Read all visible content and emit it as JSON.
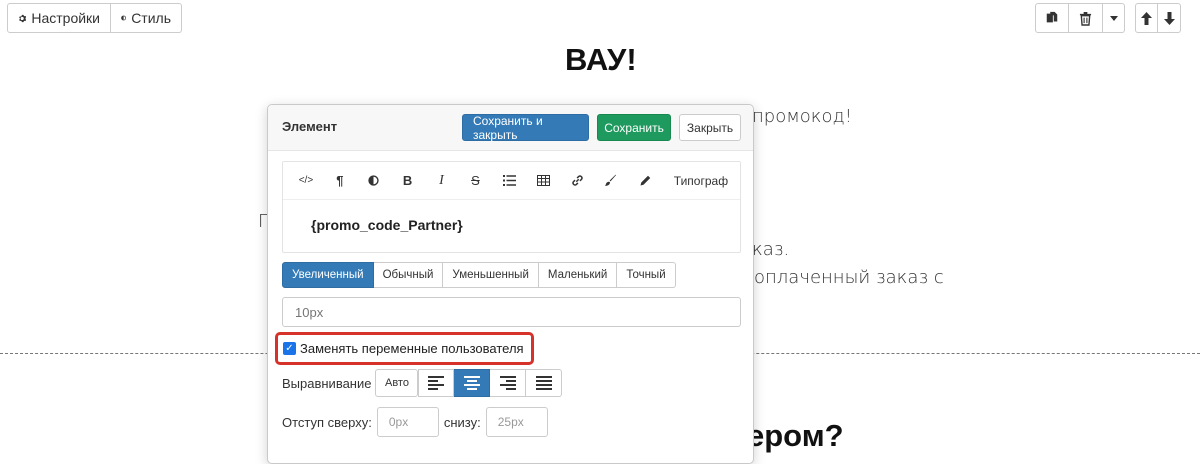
{
  "top_toolbar": {
    "settings_label": "Настройки",
    "style_label": "Стиль",
    "right_group_icons": [
      "copy-icon",
      "trash-icon",
      "caret-down-icon"
    ],
    "arrow_icons": [
      "arrow-up-icon",
      "arrow-down-icon"
    ]
  },
  "background": {
    "headline": "ВАУ!",
    "text_promocode": "промокод!",
    "text_letter_p": "П",
    "text_order": "аказ.",
    "text_paid_order": "оплаченный заказ с",
    "headline_bottom": "ером?"
  },
  "modal": {
    "title": "Элемент",
    "save_close_label": "Сохранить и закрыть",
    "save_label": "Сохранить",
    "close_label": "Закрыть",
    "editor_toolbar": {
      "typograph_label": "Типограф",
      "icons": [
        "code-icon",
        "paragraph-icon",
        "contrast-icon",
        "bold-icon",
        "italic-icon",
        "strikethrough-icon",
        "list-icon",
        "table-icon",
        "link-icon",
        "brush-icon",
        "pencil-icon"
      ]
    },
    "editor_content": "{promo_code_Partner}",
    "size_options": [
      "Увеличенный",
      "Обычный",
      "Уменьшенный",
      "Маленький",
      "Точный"
    ],
    "size_selected": "Увеличенный",
    "size_input_placeholder": "10px",
    "replace_vars_label": "Заменять переменные пользователя",
    "replace_vars_checked": true,
    "align_label": "Выравнивание",
    "align_auto_label": "Авто",
    "align_selected": "center",
    "offset_top_label": "Отступ сверху:",
    "offset_top_placeholder": "0px",
    "offset_bottom_label": "снизу:",
    "offset_bottom_placeholder": "25px"
  },
  "colors": {
    "primary": "#337ab7",
    "success": "#1e9a5e",
    "highlight": "#d7322a"
  }
}
